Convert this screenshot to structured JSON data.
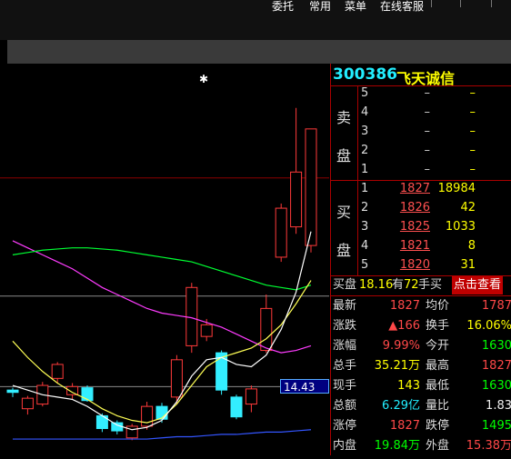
{
  "menu": [
    "委托",
    "常用",
    "菜单",
    "在线客服"
  ],
  "stock": {
    "code": "300386",
    "name": "飞天诚信"
  },
  "labels": {
    "sell": [
      "卖",
      "盘"
    ],
    "buy": [
      "买",
      "盘"
    ]
  },
  "asks": [
    {
      "level": "5",
      "price": "–",
      "vol": "–"
    },
    {
      "level": "4",
      "price": "–",
      "vol": "–"
    },
    {
      "level": "3",
      "price": "–",
      "vol": "–"
    },
    {
      "level": "2",
      "price": "–",
      "vol": "–"
    },
    {
      "level": "1",
      "price": "–",
      "vol": "–"
    }
  ],
  "bids": [
    {
      "level": "1",
      "price": "1827",
      "vol": "18984"
    },
    {
      "level": "2",
      "price": "1826",
      "vol": "42"
    },
    {
      "level": "3",
      "price": "1825",
      "vol": "1033"
    },
    {
      "level": "4",
      "price": "1821",
      "vol": "8"
    },
    {
      "level": "5",
      "price": "1820",
      "vol": "31"
    }
  ],
  "ratio": {
    "prefix": "买盘",
    "value": "18.16",
    "mid": "有",
    "count": "72",
    "suffix": "手买",
    "link": "点击查看"
  },
  "quotes": [
    {
      "l1": "最新",
      "v1": "1827",
      "c1": "red",
      "l2": "均价",
      "v2": "1787",
      "c2": "red"
    },
    {
      "l1": "涨跌",
      "v1": "▲166",
      "c1": "red",
      "l2": "换手",
      "v2": "16.06%",
      "c2": "yel"
    },
    {
      "l1": "涨幅",
      "v1": "9.99%",
      "c1": "red",
      "l2": "今开",
      "v2": "1630",
      "c2": "grn"
    },
    {
      "l1": "总手",
      "v1": "35.21万",
      "c1": "yel",
      "l2": "最高",
      "v2": "1827",
      "c2": "red"
    },
    {
      "l1": "现手",
      "v1": "143",
      "c1": "yel",
      "l2": "最低",
      "v2": "1630",
      "c2": "grn"
    },
    {
      "l1": "总额",
      "v1": "6.29亿",
      "c1": "cyan",
      "l2": "量比",
      "v2": "1.83",
      "c2": "wht"
    },
    {
      "l1": "涨停",
      "v1": "1827",
      "c1": "red",
      "l2": "跌停",
      "v2": "1495",
      "c2": "grn"
    },
    {
      "l1": "内盘",
      "v1": "19.84万",
      "c1": "grn",
      "l2": "外盘",
      "v2": "15.38万",
      "c2": "red"
    }
  ],
  "price_tag": "14.43",
  "chart_marker": "✱",
  "chart_data": {
    "type": "candlestick",
    "candles": [
      {
        "o": 10.4,
        "c": 10.3,
        "h": 10.5,
        "l": 10.1
      },
      {
        "o": 9.6,
        "c": 10.05,
        "h": 10.15,
        "l": 9.35
      },
      {
        "o": 9.8,
        "c": 10.6,
        "h": 10.75,
        "l": 9.7
      },
      {
        "o": 10.9,
        "c": 11.5,
        "h": 11.6,
        "l": 10.7
      },
      {
        "o": 10.2,
        "c": 10.55,
        "h": 10.7,
        "l": 10.0
      },
      {
        "o": 10.5,
        "c": 9.95,
        "h": 10.6,
        "l": 9.9
      },
      {
        "o": 9.3,
        "c": 8.75,
        "h": 9.4,
        "l": 8.6
      },
      {
        "o": 9.0,
        "c": 8.65,
        "h": 9.1,
        "l": 8.5
      },
      {
        "o": 8.35,
        "c": 8.85,
        "h": 8.95,
        "l": 8.25
      },
      {
        "o": 8.85,
        "c": 9.7,
        "h": 9.9,
        "l": 8.7
      },
      {
        "o": 9.7,
        "c": 9.15,
        "h": 9.85,
        "l": 9.0
      },
      {
        "o": 10.1,
        "c": 11.7,
        "h": 11.9,
        "l": 9.8
      },
      {
        "o": 12.3,
        "c": 14.8,
        "h": 15.0,
        "l": 12.0
      },
      {
        "o": 12.7,
        "c": 13.2,
        "h": 13.45,
        "l": 12.5
      },
      {
        "o": 12.0,
        "c": 10.4,
        "h": 12.1,
        "l": 10.2
      },
      {
        "o": 10.1,
        "c": 9.25,
        "h": 10.2,
        "l": 9.15
      },
      {
        "o": 9.8,
        "c": 10.45,
        "h": 10.6,
        "l": 9.45
      },
      {
        "o": 12.1,
        "c": 13.9,
        "h": 14.5,
        "l": 12.0
      },
      {
        "o": 16.1,
        "c": 18.2,
        "h": 18.4,
        "l": 15.9
      },
      {
        "o": 17.4,
        "c": 19.75,
        "h": 22.5,
        "l": 17.1
      },
      {
        "o": 16.6,
        "c": 21.6,
        "h": 21.6,
        "l": 16.3
      }
    ],
    "ma_series": [
      {
        "color": "#ff3cff",
        "values": [
          16.8,
          16.5,
          16.2,
          15.9,
          15.6,
          15.2,
          14.8,
          14.5,
          14.2,
          13.9,
          13.7,
          13.6,
          13.5,
          13.3,
          13.1,
          12.8,
          12.5,
          12.2,
          12.0,
          12.1,
          12.3
        ]
      },
      {
        "color": "#00ff33",
        "values": [
          16.2,
          16.3,
          16.4,
          16.45,
          16.5,
          16.5,
          16.45,
          16.4,
          16.3,
          16.2,
          16.1,
          16.0,
          15.9,
          15.7,
          15.5,
          15.3,
          15.1,
          14.9,
          14.8,
          14.7,
          14.9
        ]
      },
      {
        "color": "#ffff55",
        "values": [
          12.5,
          11.8,
          11.2,
          10.7,
          10.3,
          10.0,
          9.6,
          9.3,
          9.1,
          9.0,
          9.2,
          9.8,
          10.6,
          11.4,
          11.8,
          12.0,
          12.2,
          12.6,
          13.2,
          14.1,
          15.1
        ]
      },
      {
        "color": "#ffffff",
        "values": [
          10.6,
          10.4,
          10.2,
          10.1,
          10.0,
          9.7,
          9.3,
          8.9,
          8.7,
          8.8,
          9.1,
          9.9,
          11.0,
          11.7,
          11.8,
          11.5,
          11.4,
          11.9,
          13.0,
          14.6,
          17.2
        ]
      },
      {
        "color": "#3355ff",
        "values": [
          8.3,
          8.3,
          8.3,
          8.3,
          8.3,
          8.3,
          8.3,
          8.3,
          8.3,
          8.3,
          8.35,
          8.4,
          8.4,
          8.45,
          8.5,
          8.5,
          8.55,
          8.6,
          8.6,
          8.65,
          8.7
        ]
      }
    ],
    "hlines": [
      {
        "value": 19.5,
        "color": "#8b0000"
      },
      {
        "value": 14.43,
        "color": "#8a8a8a"
      },
      {
        "value": 10.55,
        "color": "#8a8a8a"
      }
    ]
  }
}
